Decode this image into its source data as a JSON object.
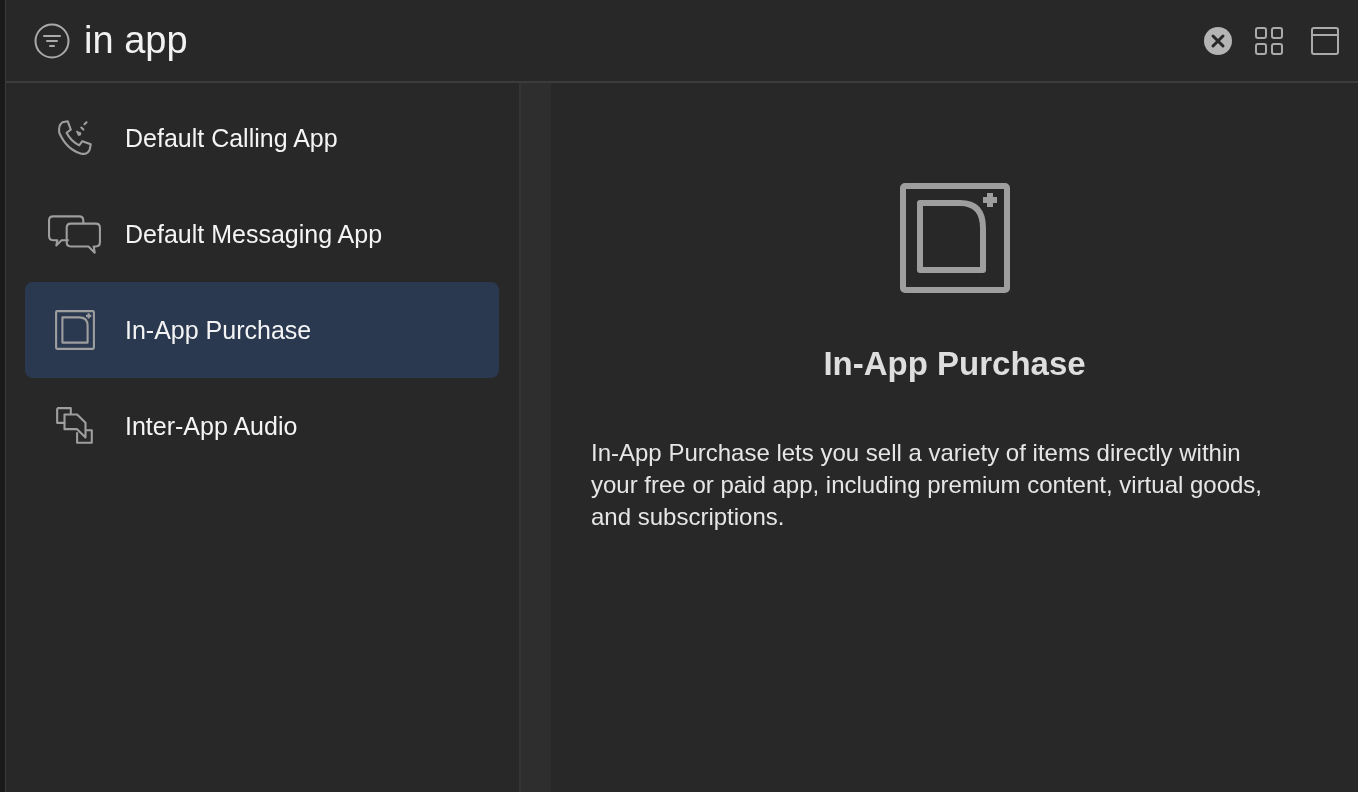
{
  "search": {
    "value": "in app"
  },
  "items": [
    {
      "label": "Default Calling App",
      "kind": "phone",
      "selected": false
    },
    {
      "label": "Default Messaging App",
      "kind": "messages",
      "selected": false
    },
    {
      "label": "In-App Purchase",
      "kind": "purchase",
      "selected": true
    },
    {
      "label": "Inter-App Audio",
      "kind": "audio",
      "selected": false
    }
  ],
  "detail": {
    "kind": "purchase",
    "title": "In-App Purchase",
    "description": "In-App Purchase lets you sell a variety of items directly within your free or paid app, including premium content, virtual goods, and subscriptions."
  }
}
